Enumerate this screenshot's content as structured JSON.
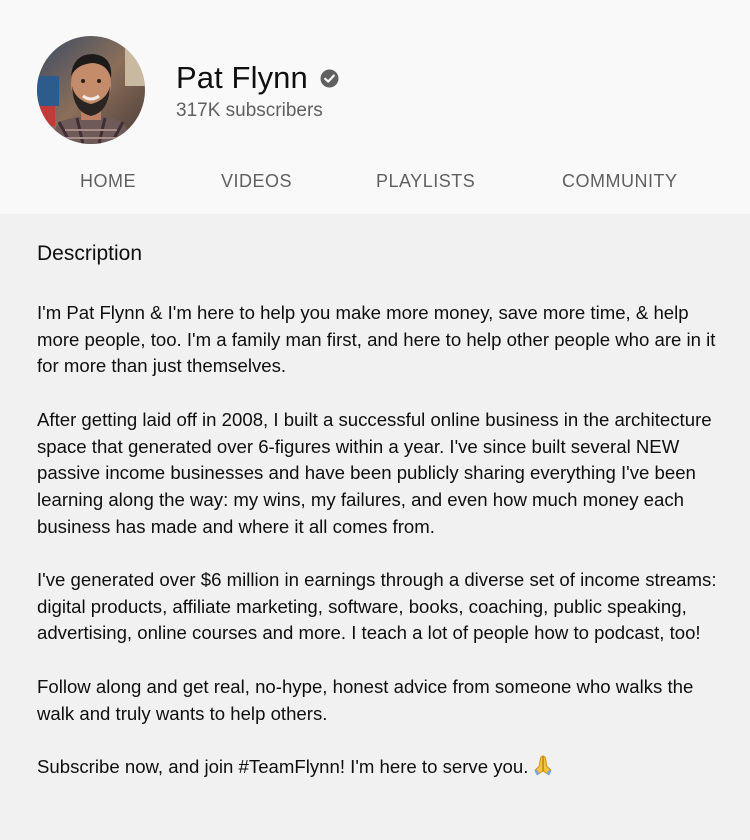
{
  "channel": {
    "name": "Pat Flynn",
    "subscribers": "317K subscribers",
    "verified_icon": "verified-check-icon"
  },
  "tabs": [
    {
      "label": "HOME"
    },
    {
      "label": "VIDEOS"
    },
    {
      "label": "PLAYLISTS"
    },
    {
      "label": "COMMUNITY"
    }
  ],
  "description": {
    "title": "Description",
    "paragraphs": [
      "I'm Pat Flynn & I'm here to help you make more money, save more time, & help more people, too. I'm a family man first, and here to help other people who are in it for more than just themselves.",
      "After getting laid off in 2008, I built a successful online business in the architecture space that generated over 6-figures within a year. I've since built several NEW passive income businesses and have been publicly sharing everything I've been learning along the way: my wins, my failures, and even how much money each business has made and where it all comes from.",
      "I've generated over $6 million in earnings through a diverse set of income streams: digital products, affiliate marketing, software, books, coaching, public speaking, advertising, online courses and more. I teach a lot of people how to podcast, too!",
      "Follow along and get real, no-hype, honest advice from someone who walks the walk and truly wants to help others.",
      "Subscribe now, and join #TeamFlynn! I'm here to serve you."
    ],
    "closing_emoji_icon": "folded-hands-icon"
  },
  "colors": {
    "header_bg": "#f9f9f9",
    "body_bg": "#f1f1f1",
    "primary_text": "#0f0f0f",
    "secondary_text": "#606060",
    "emoji_yellow": "#f7c23c"
  }
}
